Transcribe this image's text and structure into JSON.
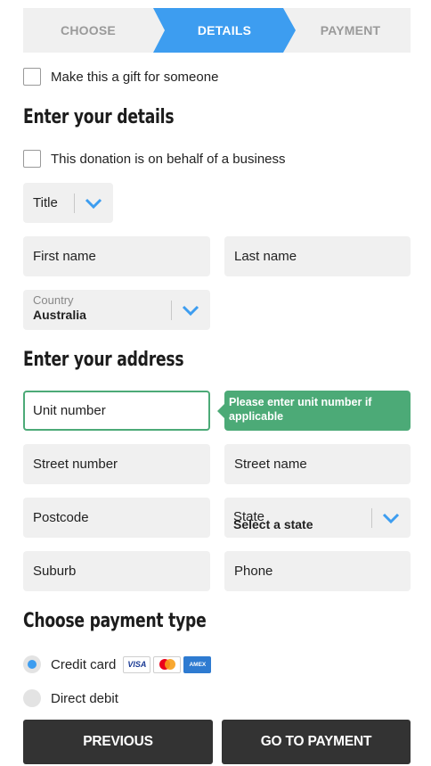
{
  "stepper": {
    "steps": [
      {
        "label": "CHOOSE",
        "state": "done"
      },
      {
        "label": "DETAILS",
        "state": "active"
      },
      {
        "label": "PAYMENT",
        "state": "upcoming"
      }
    ],
    "active_color": "#3d9df0"
  },
  "gift": {
    "label": "Make this a gift for someone",
    "checked": false
  },
  "details": {
    "heading": "Enter your details",
    "business": {
      "label": "This donation is on behalf of a business",
      "checked": false
    },
    "title_select": {
      "placeholder": "Title"
    },
    "first_name": {
      "placeholder": "First name"
    },
    "last_name": {
      "placeholder": "Last name"
    },
    "country": {
      "label": "Country",
      "value": "Australia"
    }
  },
  "address": {
    "heading": "Enter your address",
    "unit_number": {
      "placeholder": "Unit number"
    },
    "tooltip": "Please enter unit number if applicable",
    "street_number": {
      "placeholder": "Street number"
    },
    "street_name": {
      "placeholder": "Street name"
    },
    "postcode": {
      "placeholder": "Postcode"
    },
    "state": {
      "label": "State",
      "value": "Select a state"
    },
    "suburb": {
      "placeholder": "Suburb"
    },
    "phone": {
      "placeholder": "Phone"
    }
  },
  "payment": {
    "heading": "Choose payment type",
    "options": [
      {
        "label": "Credit card",
        "selected": true
      },
      {
        "label": "Direct debit",
        "selected": false
      }
    ],
    "cards": [
      "VISA",
      "mastercard",
      "AMEX"
    ]
  },
  "buttons": {
    "previous": "PREVIOUS",
    "next": "GO TO PAYMENT"
  },
  "colors": {
    "accent": "#3d9df0",
    "success": "#4caa77",
    "button": "#333333",
    "field": "#f0f0f0"
  }
}
